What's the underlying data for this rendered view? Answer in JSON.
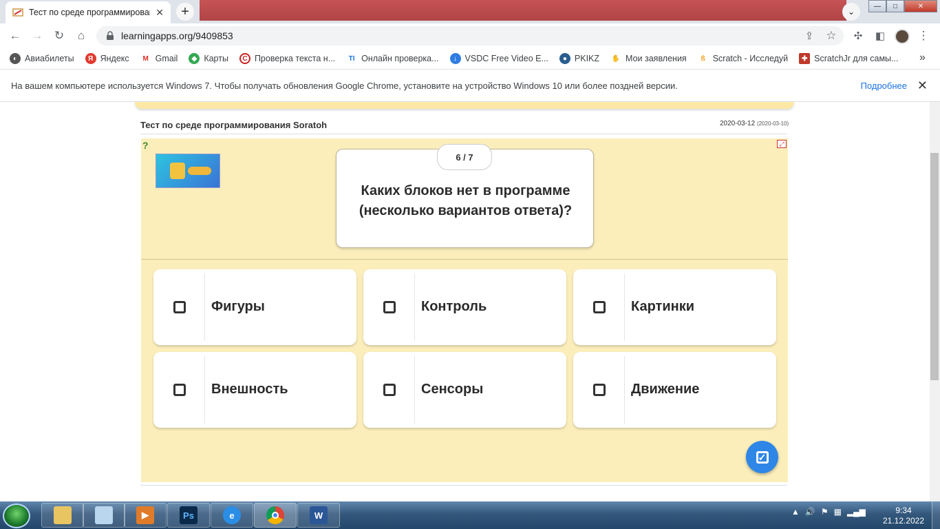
{
  "browser": {
    "tab_title": "Тест по среде программирован",
    "tab_close": "✕",
    "new_tab": "+",
    "url": "learningapps.org/9409853",
    "window_controls": {
      "minimize": "—",
      "maximize": "□",
      "close": "✕"
    }
  },
  "bookmarks": [
    {
      "label": "Авиабилеты",
      "icon": "globe-icon",
      "color": "#555555"
    },
    {
      "label": "Яндекс",
      "icon": "yandex-icon",
      "color": "#e03a2f"
    },
    {
      "label": "Gmail",
      "icon": "gmail-icon",
      "color": "#d93025"
    },
    {
      "label": "Карты",
      "icon": "maps-icon",
      "color": "#34a853"
    },
    {
      "label": "Проверка текста н...",
      "icon": "copyright-icon",
      "color": "#c5221f"
    },
    {
      "label": "Онлайн проверка...",
      "icon": "ti-icon",
      "color": "#1a73e8"
    },
    {
      "label": "VSDC Free Video E...",
      "icon": "vsdc-icon",
      "color": "#2f7de1"
    },
    {
      "label": "PKIKZ",
      "icon": "pkikz-icon",
      "color": "#2a5d8f"
    },
    {
      "label": "Мои заявления",
      "icon": "hand-icon",
      "color": "#8e44ad"
    },
    {
      "label": "Scratch - Исследуй",
      "icon": "scratch-icon",
      "color": "#f39c12"
    },
    {
      "label": "ScratchJr для самы...",
      "icon": "scratchjr-icon",
      "color": "#c0392b"
    }
  ],
  "bookmarks_more": "»",
  "infobar": {
    "message": "На вашем компьютере используется Windows 7. Чтобы получать обновления Google Chrome, установите на устройство Windows 10 или более поздней версии.",
    "link": "Подробнее",
    "close": "✕"
  },
  "app": {
    "title": "Тест по среде программирования Soratoh",
    "date": "2020-03-12",
    "date_small": "(2020-03-10)",
    "counter": "6 / 7",
    "question": "Каких блоков нет в программе (несколько вариантов ответа)?",
    "options": [
      "Фигуры",
      "Контроль",
      "Картинки",
      "Внешность",
      "Сенсоры",
      "Движение"
    ]
  },
  "taskbar": {
    "apps": [
      "explorer",
      "notepad",
      "media-player",
      "photoshop",
      "internet-explorer",
      "chrome",
      "word"
    ],
    "clock_time": "9:34",
    "clock_date": "21.12.2022"
  },
  "colors": {
    "game_bg": "#fbeebb",
    "check_button": "#2e86e6",
    "brand_link": "#1a73e8"
  }
}
